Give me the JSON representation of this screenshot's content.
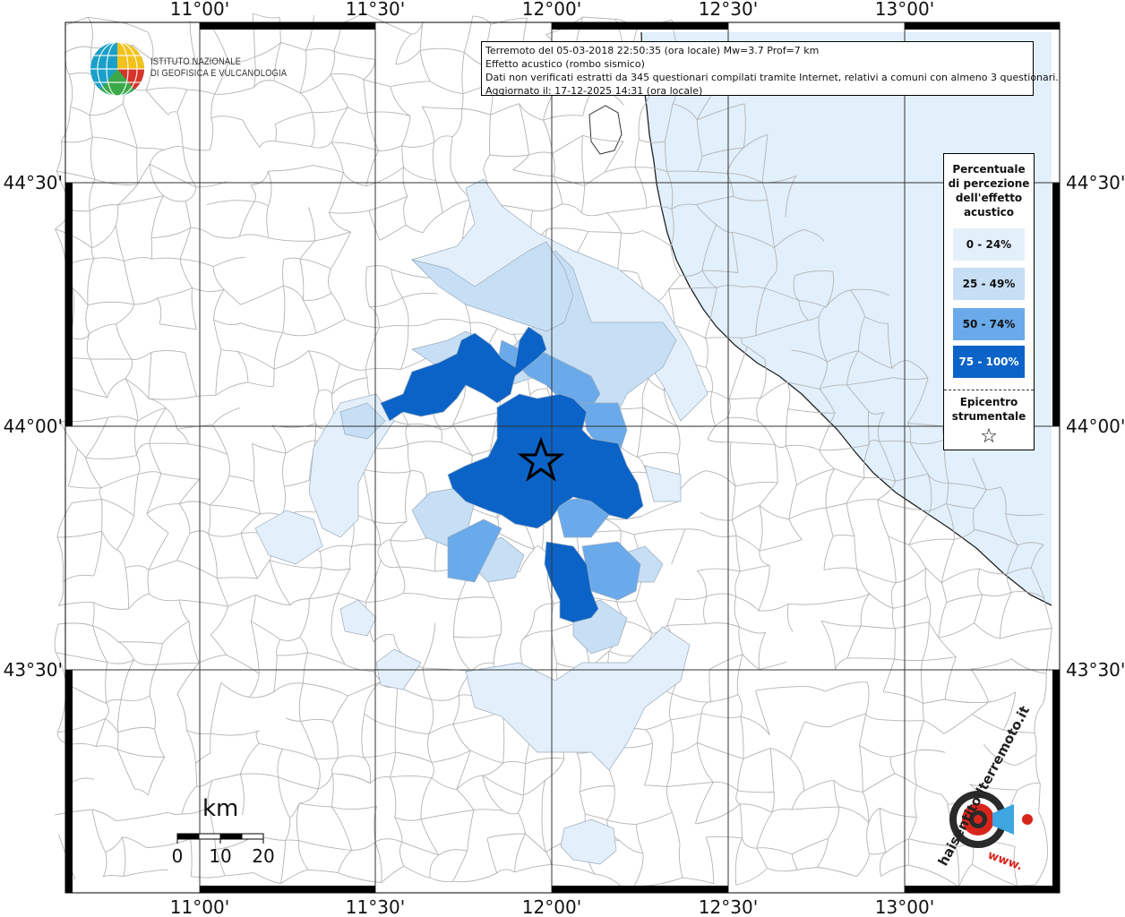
{
  "map": {
    "longitude_ticks": [
      "11°00'",
      "11°30'",
      "12°00'",
      "12°30'",
      "13°00'"
    ],
    "latitude_ticks": [
      "44°30'",
      "44°00'",
      "43°30'"
    ]
  },
  "institution": {
    "line1": "ISTITUTO NAZIONALE",
    "line2": "DI GEOFISICA E VULCANOLOGIA"
  },
  "info": {
    "line1": "Terremoto del 05-03-2018 22:50:35 (ora locale) Mw=3.7 Prof=7 km",
    "line2": "Effetto acustico (rombo sismico)",
    "line3": "Dati non verificati estratti da 345 questionari compilati tramite Internet, relativi a comuni con almeno 3 questionari.",
    "line4": "Aggiornato il: 17-12-2025 14:31 (ora locale)"
  },
  "legend": {
    "title_lines": [
      "Percentuale",
      "di percezione",
      "dell'effetto",
      "acustico"
    ],
    "classes": [
      {
        "label": "0 - 24%",
        "color": "#e3f0fb"
      },
      {
        "label": "25 - 49%",
        "color": "#c7dff5"
      },
      {
        "label": "50 - 74%",
        "color": "#6aaaea"
      },
      {
        "label": "75 - 100%",
        "color": "#0b63c7"
      }
    ],
    "epicenter_lines": [
      "Epicentro",
      "strumentale"
    ],
    "epicenter_symbol": "☆"
  },
  "scale_bar": {
    "title": "km",
    "labels": [
      "0",
      "10",
      "20"
    ]
  },
  "colors": {
    "sea": "#e1f0fb",
    "boundaries": "#b4b4b4",
    "grid": "#333333"
  },
  "watermark": {
    "text": "haisentitoilterremoto.it",
    "site": "www."
  }
}
